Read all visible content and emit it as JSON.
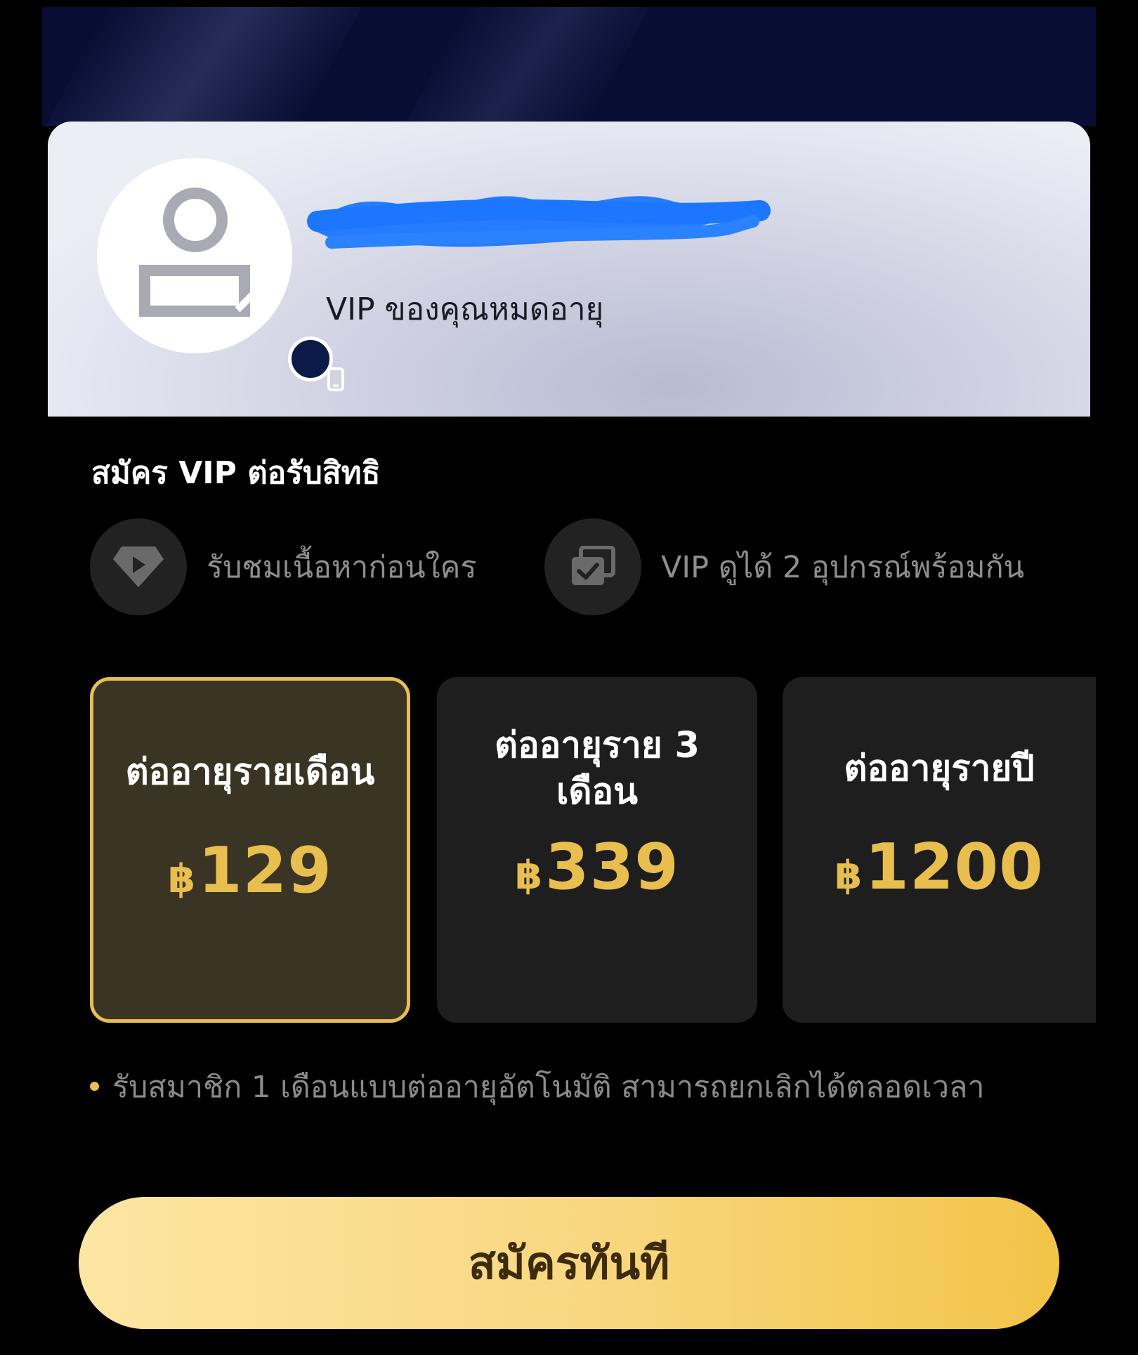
{
  "colors": {
    "background": "#000000",
    "accent_gold": "#e8be4e",
    "selected_border": "#e7bd55",
    "card_dark": "#1e1e1e",
    "card_selected": "#3a3424",
    "button_text": "#3e2b0c"
  },
  "profile": {
    "username": "",
    "username_redacted": true,
    "vip_status": "VIP ของคุณหมดอายุ",
    "avatar_icon": "user-placeholder-icon",
    "badge_icon": "phone-icon"
  },
  "benefits": {
    "title": "สมัคร VIP ต่อรับสิทธิ",
    "items": [
      {
        "icon": "diamond-play-icon",
        "label": "รับชมเนื้อหาก่อนใคร"
      },
      {
        "icon": "multi-device-check-icon",
        "label": "VIP ดูได้ 2 อุปกรณ์พร้อมกัน"
      }
    ]
  },
  "plans": [
    {
      "name": "ต่ออายุรายเดือน",
      "currency": "฿",
      "amount": "129",
      "selected": true
    },
    {
      "name": "ต่ออายุราย 3 เดือน",
      "currency": "฿",
      "amount": "339",
      "selected": false
    },
    {
      "name": "ต่ออายุรายปี",
      "currency": "฿",
      "amount": "1200",
      "selected": false
    }
  ],
  "note": "รับสมาชิก 1 เดือนแบบต่ออายุอัตโนมัติ สามารถยกเลิกได้ตลอดเวลา",
  "subscribe_button": "สมัครทันที"
}
